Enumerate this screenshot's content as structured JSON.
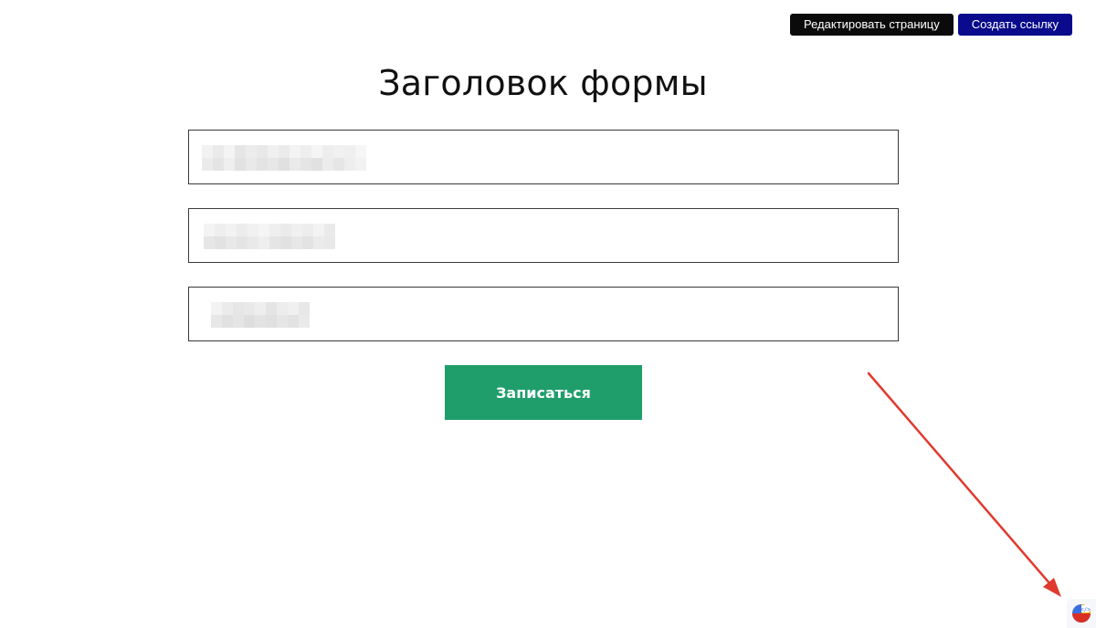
{
  "toolbar": {
    "edit_label": "Редактировать страницу",
    "create_link_label": "Создать ссылку"
  },
  "form": {
    "title": "Заголовок формы",
    "fields": [
      {
        "value_obscured": true
      },
      {
        "value_obscured": true
      },
      {
        "value_obscured": true
      }
    ],
    "submit_label": "Записаться"
  },
  "colors": {
    "edit_button": "#0b0b0b",
    "create_link_button": "#0a0a8c",
    "submit_button": "#1f9e6b",
    "annotation_arrow": "#e03a2f"
  },
  "icons": {
    "extension": "devtools-extension-icon"
  }
}
